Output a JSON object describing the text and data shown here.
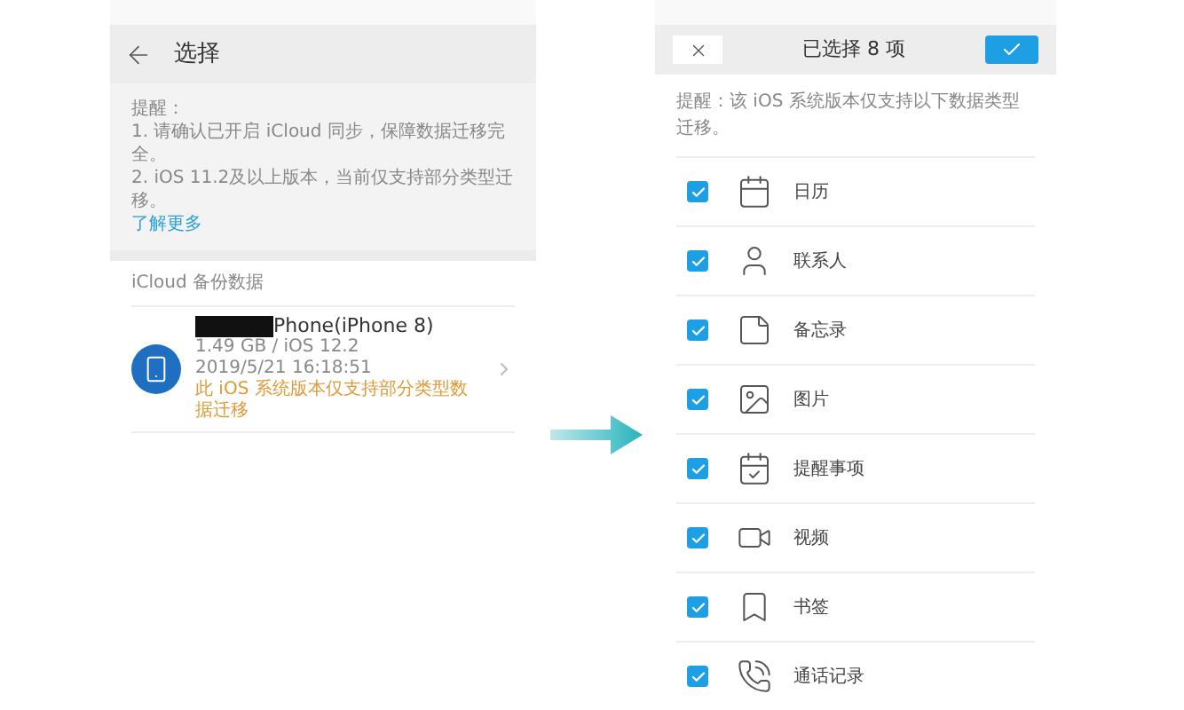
{
  "left_screen": {
    "title": "选择",
    "tip_label": "提醒：",
    "tips": [
      "1. 请确认已开启 iCloud 同步，保障数据迁移完全。",
      "2. iOS 11.2及以上版本，当前仅支持部分类型迁移。"
    ],
    "learn_more": "了解更多",
    "section_title": "iCloud 备份数据",
    "backup": {
      "name": "Phone(iPhone 8)",
      "size": "1.49 GB / iOS 12.2",
      "date": "2019/5/21 16:18:51",
      "warning": "此 iOS 系统版本仅支持部分类型数据迁移"
    }
  },
  "right_screen": {
    "title": "已选择 8 项",
    "tip": "提醒：该 iOS 系统版本仅支持以下数据类型迁移。",
    "items": [
      {
        "label": "日历",
        "checked": true
      },
      {
        "label": "联系人",
        "checked": true
      },
      {
        "label": "备忘录",
        "checked": true
      },
      {
        "label": "图片",
        "checked": true
      },
      {
        "label": "提醒事项",
        "checked": true
      },
      {
        "label": "视频",
        "checked": true
      },
      {
        "label": "书签",
        "checked": true
      },
      {
        "label": "通话记录",
        "checked": true
      }
    ]
  }
}
